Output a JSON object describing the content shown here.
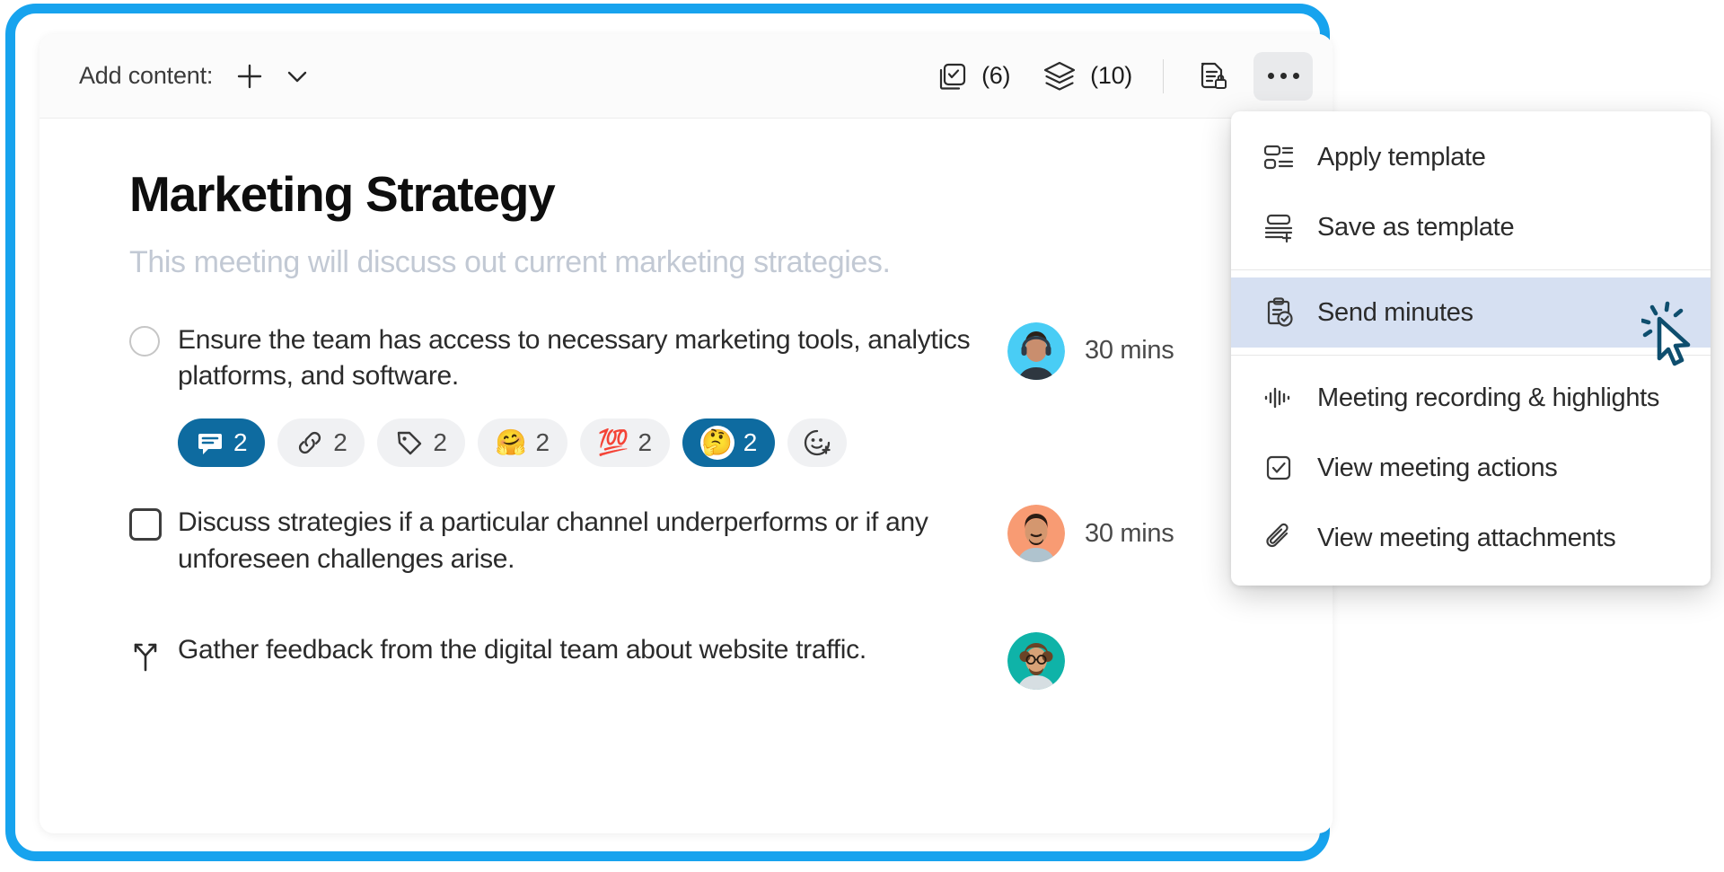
{
  "toolbar": {
    "add_content_label": "Add content:",
    "plus_icon": "plus-icon",
    "chevron_icon": "chevron-down-icon",
    "actions_count": "(6)",
    "layers_count": "(10)",
    "actions_icon": "checkbox-copy-icon",
    "layers_icon": "layers-icon",
    "private_doc_icon": "document-lock-icon",
    "more_icon": "more-horizontal-icon"
  },
  "document": {
    "title": "Marketing Strategy",
    "subtitle": "This meeting will discuss out current marketing strategies."
  },
  "agenda": [
    {
      "marker": "circle-unchecked",
      "text": "Ensure the team has access to necessary marketing tools, analytics platforms, and software.",
      "duration": "30 mins",
      "avatar_color": "#49CDF5",
      "avatar_name": "avatar-headset-person"
    },
    {
      "marker": "square-unchecked",
      "text": "Discuss strategies if a particular channel underperforms or if any unforeseen challenges arise.",
      "duration": "30 mins",
      "avatar_color": "#F89B73",
      "avatar_name": "avatar-bearded-person"
    },
    {
      "marker": "decision-branch",
      "text": "Gather feedback from the digital team about website traffic.",
      "duration": "",
      "avatar_color": "#0FB3A8",
      "avatar_name": "avatar-curly-hair-person"
    }
  ],
  "reactions": [
    {
      "icon": "comment-icon",
      "emoji": "",
      "count": "2",
      "active": true
    },
    {
      "icon": "link-icon",
      "emoji": "",
      "count": "2",
      "active": false
    },
    {
      "icon": "tag-icon",
      "emoji": "",
      "count": "2",
      "active": false
    },
    {
      "icon": "emoji-hug",
      "emoji": "🤗",
      "count": "2",
      "active": false
    },
    {
      "icon": "emoji-100",
      "emoji": "💯",
      "count": "2",
      "active": false
    },
    {
      "icon": "emoji-thinking",
      "emoji": "🤔",
      "count": "2",
      "active": true
    },
    {
      "icon": "add-reaction-icon",
      "emoji": "",
      "count": "",
      "active": false
    }
  ],
  "menu": {
    "items": [
      {
        "label": "Apply template",
        "icon": "apply-template-icon",
        "highlight": false
      },
      {
        "label": "Save as template",
        "icon": "save-template-icon",
        "highlight": false
      },
      {
        "label": "Send minutes",
        "icon": "clipboard-check-icon",
        "highlight": true
      },
      {
        "label": "Meeting recording & highlights",
        "icon": "waveform-icon",
        "highlight": false
      },
      {
        "label": "View meeting actions",
        "icon": "checkbox-icon",
        "highlight": false
      },
      {
        "label": "View meeting attachments",
        "icon": "paperclip-icon",
        "highlight": false
      }
    ]
  },
  "colors": {
    "frame_blue": "#17A3EE",
    "chip_active": "#0E6BA0",
    "menu_highlight": "#D6E0F2",
    "subtitle_grey": "#C2C9D4"
  },
  "cursor": {
    "name": "click-cursor"
  }
}
